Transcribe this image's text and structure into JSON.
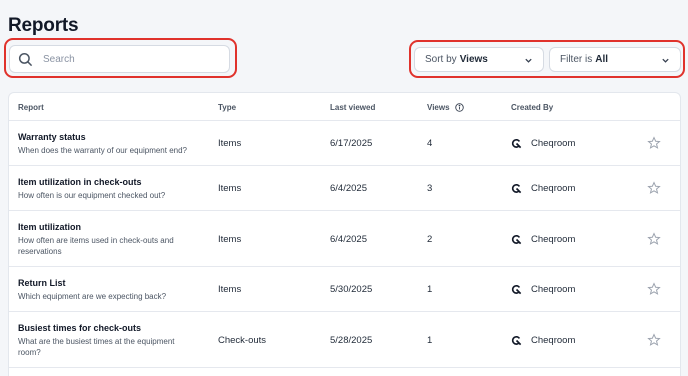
{
  "page": {
    "title": "Reports"
  },
  "search": {
    "placeholder": "Search",
    "value": ""
  },
  "sort": {
    "prefix": "Sort by",
    "value": "Views"
  },
  "filter": {
    "prefix": "Filter is",
    "value": "All"
  },
  "table": {
    "columns": [
      "Report",
      "Type",
      "Last viewed",
      "Views",
      "Created By"
    ],
    "rows": [
      {
        "name": "Warranty status",
        "desc": "When does the warranty of our equipment end?",
        "type": "Items",
        "last_viewed": "6/17/2025",
        "views": "4",
        "created_by": "Cheqroom"
      },
      {
        "name": "Item utilization in check-outs",
        "desc": "How often is our equipment checked out?",
        "type": "Items",
        "last_viewed": "6/4/2025",
        "views": "3",
        "created_by": "Cheqroom"
      },
      {
        "name": "Item utilization",
        "desc": "How often are items used in check-outs and reservations",
        "type": "Items",
        "last_viewed": "6/4/2025",
        "views": "2",
        "created_by": "Cheqroom"
      },
      {
        "name": "Return List",
        "desc": "Which equipment are we expecting back?",
        "type": "Items",
        "last_viewed": "5/30/2025",
        "views": "1",
        "created_by": "Cheqroom"
      },
      {
        "name": "Busiest times for check-outs",
        "desc": "What are the busiest times at the equipment room?",
        "type": "Check-outs",
        "last_viewed": "5/28/2025",
        "views": "1",
        "created_by": "Cheqroom"
      }
    ]
  },
  "icons": {
    "search": "search-icon",
    "chevron": "chevron-down-icon",
    "info": "info-icon",
    "creator_logo": "cheqroom-logo-icon",
    "favorite": "star-icon"
  },
  "colors": {
    "highlight": "#e0322c",
    "background": "#f4f6f9"
  }
}
